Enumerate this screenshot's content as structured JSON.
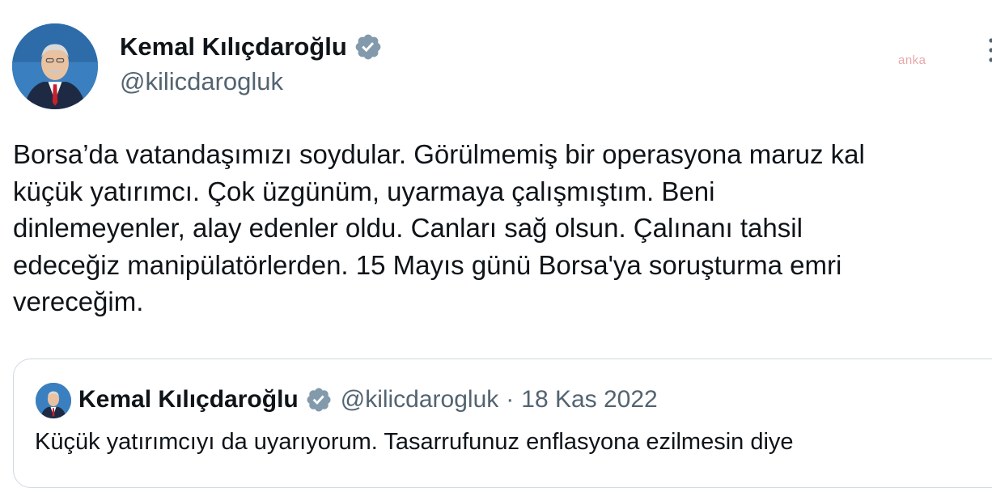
{
  "author": {
    "display_name": "Kemal Kılıçdaroğlu",
    "handle": "@kilicdarogluk",
    "verified": true,
    "avatar_icon": "profile-photo"
  },
  "watermark": "anka",
  "tweet": {
    "text": "Borsa’da vatandaşımızı soydular. Görülmemiş bir operasyona maruz kal\nküçük yatırımcı. Çok üzgünüm, uyarmaya çalışmıştım. Beni\ndinlemeyenler, alay edenler oldu. Canları sağ olsun. Çalınanı tahsil\nedeceğiz manipülatörlerden. 15 Mayıs günü Borsa'ya soruşturma emri\nvereceğim."
  },
  "quoted_tweet": {
    "display_name": "Kemal Kılıçdaroğlu",
    "handle": "@kilicdarogluk",
    "separator": "·",
    "date": "18 Kas 2022",
    "text": "Küçük yatırımcıyı da uyarıyorum. Tasarrufunuz enflasyona ezilmesin diye"
  },
  "colors": {
    "verified_badge": "#829aab",
    "secondary_text": "#536471",
    "border": "#cfd9de"
  }
}
